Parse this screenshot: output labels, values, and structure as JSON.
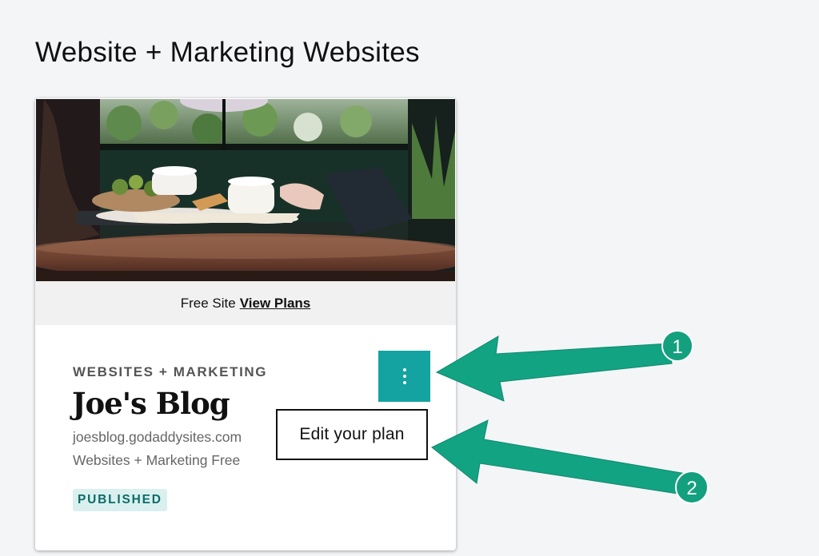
{
  "page": {
    "title": "Website + Marketing Websites"
  },
  "card": {
    "plan_strip": {
      "prefix": "Free Site",
      "link": "View Plans"
    },
    "product_label": "WEBSITES + MARKETING",
    "site_name": "Joe's Blog",
    "domain": "joesblog.godaddysites.com",
    "plan": "Websites + Marketing Free",
    "status": "PUBLISHED",
    "image": "cafe-table-with-coffee-cups-photo"
  },
  "menu": {
    "edit_plan": "Edit your plan"
  },
  "callouts": {
    "first": "1",
    "second": "2"
  },
  "colors": {
    "accent": "#14a3a1",
    "arrow": "#12a383",
    "badge_bg": "#d9f0ef",
    "badge_text": "#0d6b68"
  },
  "icons": {
    "menu_button": "kebab-menu-icon"
  }
}
